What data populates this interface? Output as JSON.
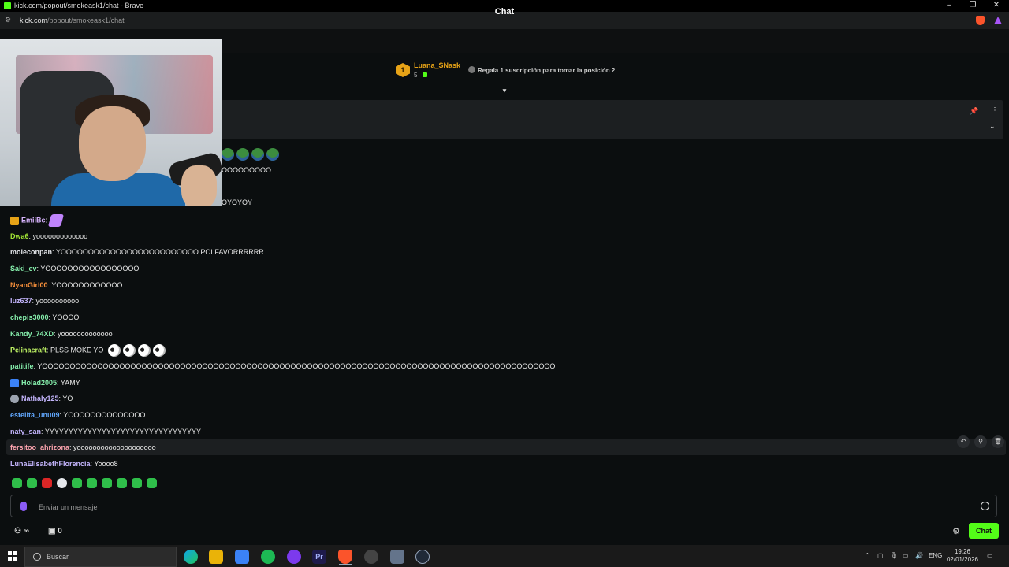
{
  "window": {
    "title": "kick.com/popout/smokeask1/chat - Brave",
    "url_host": "kick.com",
    "url_path": "/popout/smokeask1/chat"
  },
  "chat": {
    "title": "Chat",
    "leaderboard": {
      "rank": "1",
      "user": "Luana_SNask",
      "count": "5",
      "cta": "Regala 1 suscripción para tomar la posición 2"
    },
    "partial_lines": [
      "OOOOOOOOO",
      "OYOYOY"
    ],
    "messages": [
      {
        "user": "EmiiBc",
        "text": "",
        "color": "#d8b4fe"
      },
      {
        "user": "Dwa6",
        "text": "yooooooooooooo",
        "color": "#a3e635"
      },
      {
        "user": "moleconpan",
        "text": "YOOOOOOOOOOOOOOOOOOOOOOOOO POLFAVORRRRRR",
        "color": "#e5e7eb"
      },
      {
        "user": "Saki_ev",
        "text": "YOOOOOOOOOOOOOOOOO",
        "color": "#86efac"
      },
      {
        "user": "NyanGirl00",
        "text": "YOOOOOOOOOOOO",
        "color": "#fb923c"
      },
      {
        "user": "luz637",
        "text": "yoooooooooo",
        "color": "#c4b5fd"
      },
      {
        "user": "chepis3000",
        "text": "YOOOO",
        "color": "#86efac"
      },
      {
        "user": "Kandy_74XD",
        "text": "yooooooooooooo",
        "color": "#86efac"
      },
      {
        "user": "Pelinacraft",
        "text": "PLSS MOKE YO",
        "color": "#bef264"
      },
      {
        "user": "patitife",
        "text": "YOOOOOOOOOOOOOOOOOOOOOOOOOOOOOOOOOOOOOOOOOOOOOOOOOOOOOOOOOOOOOOOOOOOOOOOOOOOOOOOOOOOOOOOOOOOOO",
        "color": "#86efac"
      },
      {
        "user": "Holad2005",
        "text": "YAMY",
        "color": "#86efac"
      },
      {
        "user": "Nathaly125",
        "text": "YO",
        "color": "#c4b5fd"
      },
      {
        "user": "estelita_unu09",
        "text": "YOOOOOOOOOOOOOO",
        "color": "#60a5fa"
      },
      {
        "user": "naty_san",
        "text": "YYYYYYYYYYYYYYYYYYYYYYYYYYYYYYYYY",
        "color": "#c4b5fd"
      },
      {
        "user": "fersitoo_ahrizona",
        "text": "yoooooooooooooooooooo",
        "color": "#fda4af"
      },
      {
        "user": "LunaElisabethFlorencia",
        "text": "Yoooo8",
        "color": "#c4b5fd"
      }
    ],
    "input_placeholder": "Enviar un mensaje",
    "viewer_count": "0",
    "send_label": "Chat",
    "accent": "#53fc18"
  },
  "taskbar": {
    "search_label": "Buscar",
    "language": "ENG",
    "time": "19:26",
    "date": "02/01/2026"
  }
}
